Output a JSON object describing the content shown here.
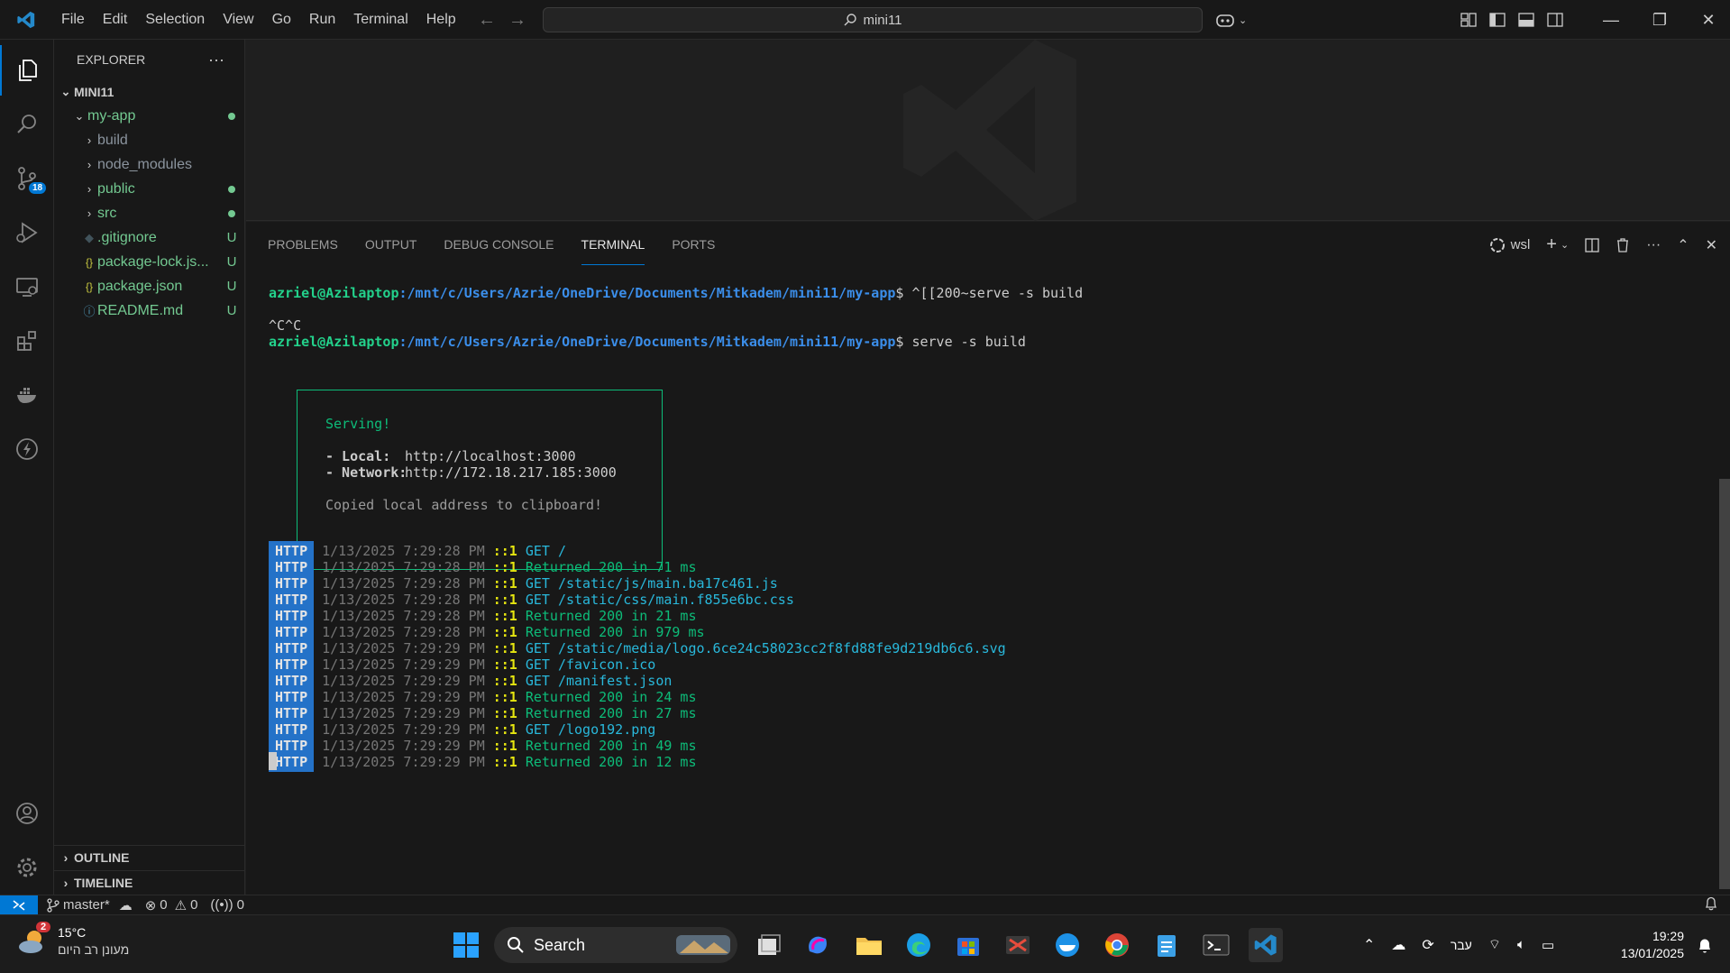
{
  "titlebar": {
    "menu": [
      "File",
      "Edit",
      "Selection",
      "View",
      "Go",
      "Run",
      "Terminal",
      "Help"
    ],
    "search": "mini11"
  },
  "activity": {
    "source_control_badge": "18"
  },
  "sidebar": {
    "title": "EXPLORER",
    "more": "···",
    "root": "MINI11",
    "tree": [
      {
        "name": "my-app",
        "deco": "dot"
      },
      {
        "name": "build",
        "deco": ""
      },
      {
        "name": "node_modules",
        "deco": ""
      },
      {
        "name": "public",
        "deco": "dot"
      },
      {
        "name": "src",
        "deco": "dot"
      },
      {
        "name": ".gitignore",
        "deco": "U"
      },
      {
        "name": "package-lock.js...",
        "deco": "U"
      },
      {
        "name": "package.json",
        "deco": "U"
      },
      {
        "name": "README.md",
        "deco": "U"
      }
    ],
    "outline": "OUTLINE",
    "timeline": "TIMELINE"
  },
  "panel": {
    "tabs": [
      "PROBLEMS",
      "OUTPUT",
      "DEBUG CONSOLE",
      "TERMINAL",
      "PORTS"
    ],
    "active_tab": "TERMINAL",
    "terminal_name": "wsl"
  },
  "terminal": {
    "user": "azriel@Azilaptop",
    "path": ":/mnt/c/Users/Azrie/OneDrive/Documents/Mitkadem/mini11/my-app",
    "cmd1": "$ ^[[200~serve -s build",
    "ctrlc": "^C^C",
    "cmd2": "$ serve -s build",
    "serving": "Serving!",
    "local_label": "- Local:",
    "local_url": "http://localhost:3000",
    "network_label": "- Network:",
    "network_url": "http://172.18.217.185:3000",
    "copied": "Copied local address to clipboard!",
    "log": [
      {
        "tag": "HTTP",
        "ts": "1/13/2025 7:29:28 PM",
        "ip": "::1",
        "msg": "GET /",
        "kind": "get"
      },
      {
        "tag": "HTTP",
        "ts": "1/13/2025 7:29:28 PM",
        "ip": "::1",
        "msg": "Returned 200 in 71 ms",
        "kind": "ret"
      },
      {
        "tag": "HTTP",
        "ts": "1/13/2025 7:29:28 PM",
        "ip": "::1",
        "msg": "GET /static/js/main.ba17c461.js",
        "kind": "get"
      },
      {
        "tag": "HTTP",
        "ts": "1/13/2025 7:29:28 PM",
        "ip": "::1",
        "msg": "GET /static/css/main.f855e6bc.css",
        "kind": "get"
      },
      {
        "tag": "HTTP",
        "ts": "1/13/2025 7:29:28 PM",
        "ip": "::1",
        "msg": "Returned 200 in 21 ms",
        "kind": "ret"
      },
      {
        "tag": "HTTP",
        "ts": "1/13/2025 7:29:28 PM",
        "ip": "::1",
        "msg": "Returned 200 in 979 ms",
        "kind": "ret"
      },
      {
        "tag": "HTTP",
        "ts": "1/13/2025 7:29:29 PM",
        "ip": "::1",
        "msg": "GET /static/media/logo.6ce24c58023cc2f8fd88fe9d219db6c6.svg",
        "kind": "get"
      },
      {
        "tag": "HTTP",
        "ts": "1/13/2025 7:29:29 PM",
        "ip": "::1",
        "msg": "GET /favicon.ico",
        "kind": "get"
      },
      {
        "tag": "HTTP",
        "ts": "1/13/2025 7:29:29 PM",
        "ip": "::1",
        "msg": "GET /manifest.json",
        "kind": "get"
      },
      {
        "tag": "HTTP",
        "ts": "1/13/2025 7:29:29 PM",
        "ip": "::1",
        "msg": "Returned 200 in 24 ms",
        "kind": "ret"
      },
      {
        "tag": "HTTP",
        "ts": "1/13/2025 7:29:29 PM",
        "ip": "::1",
        "msg": "Returned 200 in 27 ms",
        "kind": "ret"
      },
      {
        "tag": "HTTP",
        "ts": "1/13/2025 7:29:29 PM",
        "ip": "::1",
        "msg": "GET /logo192.png",
        "kind": "get"
      },
      {
        "tag": "HTTP",
        "ts": "1/13/2025 7:29:29 PM",
        "ip": "::1",
        "msg": "Returned 200 in 49 ms",
        "kind": "ret"
      },
      {
        "tag": "HTTP",
        "ts": "1/13/2025 7:29:29 PM",
        "ip": "::1",
        "msg": "Returned 200 in 12 ms",
        "kind": "ret"
      }
    ]
  },
  "statusbar": {
    "branch": "master*",
    "errors": "0",
    "warnings": "0",
    "ports": "0"
  },
  "taskbar": {
    "weather_badge": "2",
    "temp": "15°C",
    "weather_desc": "מעונן רב היום",
    "search": "Search",
    "lang": "עבר",
    "time": "19:29",
    "date": "13/01/2025"
  },
  "colors": {
    "accent": "#0078d4",
    "git_added": "#73c991",
    "http_badge": "#2472c8"
  }
}
